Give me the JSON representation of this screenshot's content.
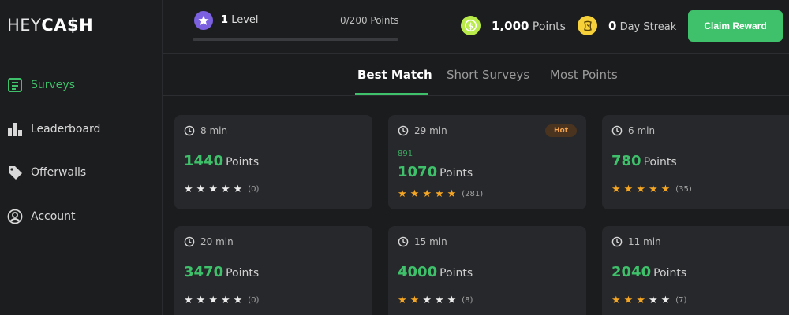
{
  "brand": {
    "part1": "HEY",
    "part2": "CA$H"
  },
  "sidebar": {
    "items": [
      {
        "label": "Surveys",
        "icon": "surveys-icon",
        "active": true
      },
      {
        "label": "Leaderboard",
        "icon": "leaderboard-icon",
        "active": false
      },
      {
        "label": "Offerwalls",
        "icon": "tag-icon",
        "active": false
      },
      {
        "label": "Account",
        "icon": "account-icon",
        "active": false
      }
    ]
  },
  "header": {
    "level": {
      "value": "1",
      "label": "Level",
      "points": "0/200 Points",
      "progress": 0
    },
    "points": {
      "value": "1,000",
      "label": "Points"
    },
    "streak": {
      "value": "0",
      "label": "Day Streak"
    },
    "claim_label": "Claim Reward"
  },
  "tabs": [
    {
      "label": "Best Match",
      "active": true
    },
    {
      "label": "Short Surveys",
      "active": false
    },
    {
      "label": "Most Points",
      "active": false
    }
  ],
  "surveys": [
    {
      "time": "8 min",
      "points": "1440",
      "points_label": "Points",
      "rating": 0,
      "reviews": "(0)",
      "hot": "",
      "old_points": ""
    },
    {
      "time": "29 min",
      "points": "1070",
      "points_label": "Points",
      "rating": 5,
      "reviews": "(281)",
      "hot": "Hot",
      "old_points": "891"
    },
    {
      "time": "6 min",
      "points": "780",
      "points_label": "Points",
      "rating": 5,
      "reviews": "(35)",
      "hot": "",
      "old_points": ""
    },
    {
      "time": "20 min",
      "points": "3470",
      "points_label": "Points",
      "rating": 0,
      "reviews": "(0)",
      "hot": "",
      "old_points": ""
    },
    {
      "time": "15 min",
      "points": "4000",
      "points_label": "Points",
      "rating": 2,
      "reviews": "(8)",
      "hot": "",
      "old_points": ""
    },
    {
      "time": "11 min",
      "points": "2040",
      "points_label": "Points",
      "rating": 3,
      "reviews": "(7)",
      "hot": "",
      "old_points": ""
    }
  ],
  "colors": {
    "accent": "#3ec16a",
    "star": "#f5a623",
    "level": "#7b61e0",
    "background": "#1b1c1e",
    "card": "#27282b"
  }
}
